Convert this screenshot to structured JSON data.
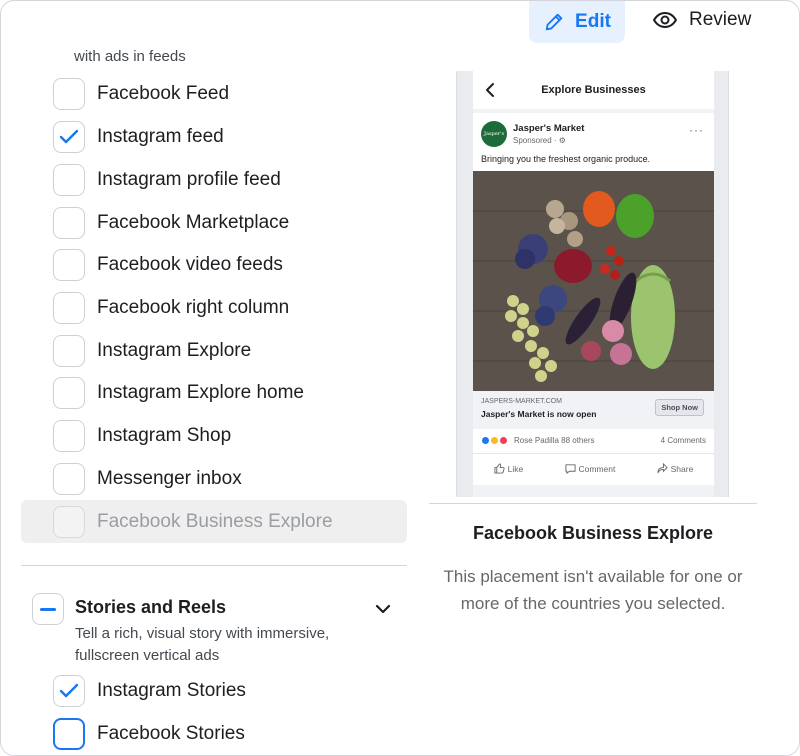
{
  "header": {
    "edit_label": "Edit",
    "review_label": "Review",
    "accent_color": "#1877f2"
  },
  "feeds_section": {
    "description_tail": "with ads in feeds",
    "items": [
      {
        "label": "Facebook Feed",
        "checked": false
      },
      {
        "label": "Instagram feed",
        "checked": true
      },
      {
        "label": "Instagram profile feed",
        "checked": false
      },
      {
        "label": "Facebook Marketplace",
        "checked": false
      },
      {
        "label": "Facebook video feeds",
        "checked": false
      },
      {
        "label": "Facebook right column",
        "checked": false
      },
      {
        "label": "Instagram Explore",
        "checked": false
      },
      {
        "label": "Instagram Explore home",
        "checked": false
      },
      {
        "label": "Instagram Shop",
        "checked": false
      },
      {
        "label": "Messenger inbox",
        "checked": false
      },
      {
        "label": "Facebook Business Explore",
        "checked": false,
        "disabled": true
      }
    ]
  },
  "stories_section": {
    "title": "Stories and Reels",
    "description": "Tell a rich, visual story with immersive, fullscreen vertical ads",
    "items": [
      {
        "label": "Instagram Stories",
        "checked": true
      },
      {
        "label": "Facebook Stories",
        "checked": false,
        "focused": true
      }
    ]
  },
  "preview": {
    "screen_title": "Explore Businesses",
    "avatar_text": "Jasper's",
    "page_name": "Jasper's Market",
    "sponsored": "Sponsored · ⚙",
    "more": "···",
    "caption": "Bringing you the freshest organic produce.",
    "cta_domain": "JASPERS-MARKET.COM",
    "cta_headline": "Jasper's Market is now open",
    "cta_button": "Shop Now",
    "reactions_text": "Rose Padilla 88 others",
    "comments": "4 Comments",
    "like": "Like",
    "comment": "Comment",
    "share": "Share"
  },
  "placement_info": {
    "title": "Facebook Business Explore",
    "message": "This placement isn't available for one or more of the countries you selected."
  }
}
